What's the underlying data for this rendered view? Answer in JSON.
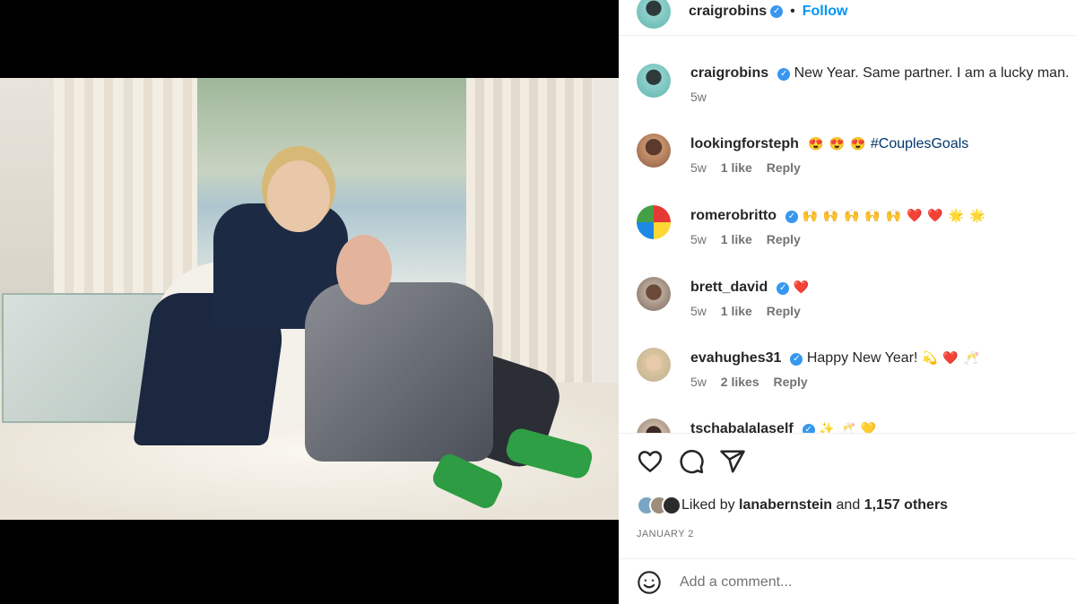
{
  "post": {
    "author": "craigrobins",
    "follow_label": "Follow",
    "dot": "•",
    "verified_glyph": "✓"
  },
  "comments": [
    {
      "user": "craigrobins",
      "verified": true,
      "text": "New Year. Same partner. I am a lucky man.",
      "time": "5w",
      "likes": "",
      "reply": ""
    },
    {
      "user": "lookingforsteph",
      "verified": false,
      "emoji": "😍 😍 😍",
      "tag": "#CouplesGoals",
      "time": "5w",
      "likes": "1 like",
      "reply": "Reply"
    },
    {
      "user": "romerobritto",
      "verified": true,
      "emoji": "🙌 🙌 🙌 🙌 🙌 ❤️ ❤️ 🌟 🌟",
      "time": "5w",
      "likes": "1 like",
      "reply": "Reply"
    },
    {
      "user": "brett_david",
      "verified": true,
      "emoji": "❤️",
      "time": "5w",
      "likes": "1 like",
      "reply": "Reply"
    },
    {
      "user": "evahughes31",
      "verified": true,
      "text": "Happy New Year!",
      "emoji": "💫 ❤️ 🥂",
      "time": "5w",
      "likes": "2 likes",
      "reply": "Reply"
    },
    {
      "user": "tschabalalaself",
      "verified": true,
      "emoji": "✨ 🥂 💛"
    }
  ],
  "likes": {
    "prefix": "Liked by",
    "user": "lanabernstein",
    "mid": "and",
    "count": "1,157 others"
  },
  "date": "JANUARY 2",
  "add_comment": {
    "placeholder": "Add a comment..."
  },
  "icons": [
    "heart-icon",
    "comment-icon",
    "share-icon",
    "emoji-icon"
  ],
  "colors": {
    "accent": "#0095f6",
    "verified": "#3797f0",
    "heart": "#ed4956"
  }
}
